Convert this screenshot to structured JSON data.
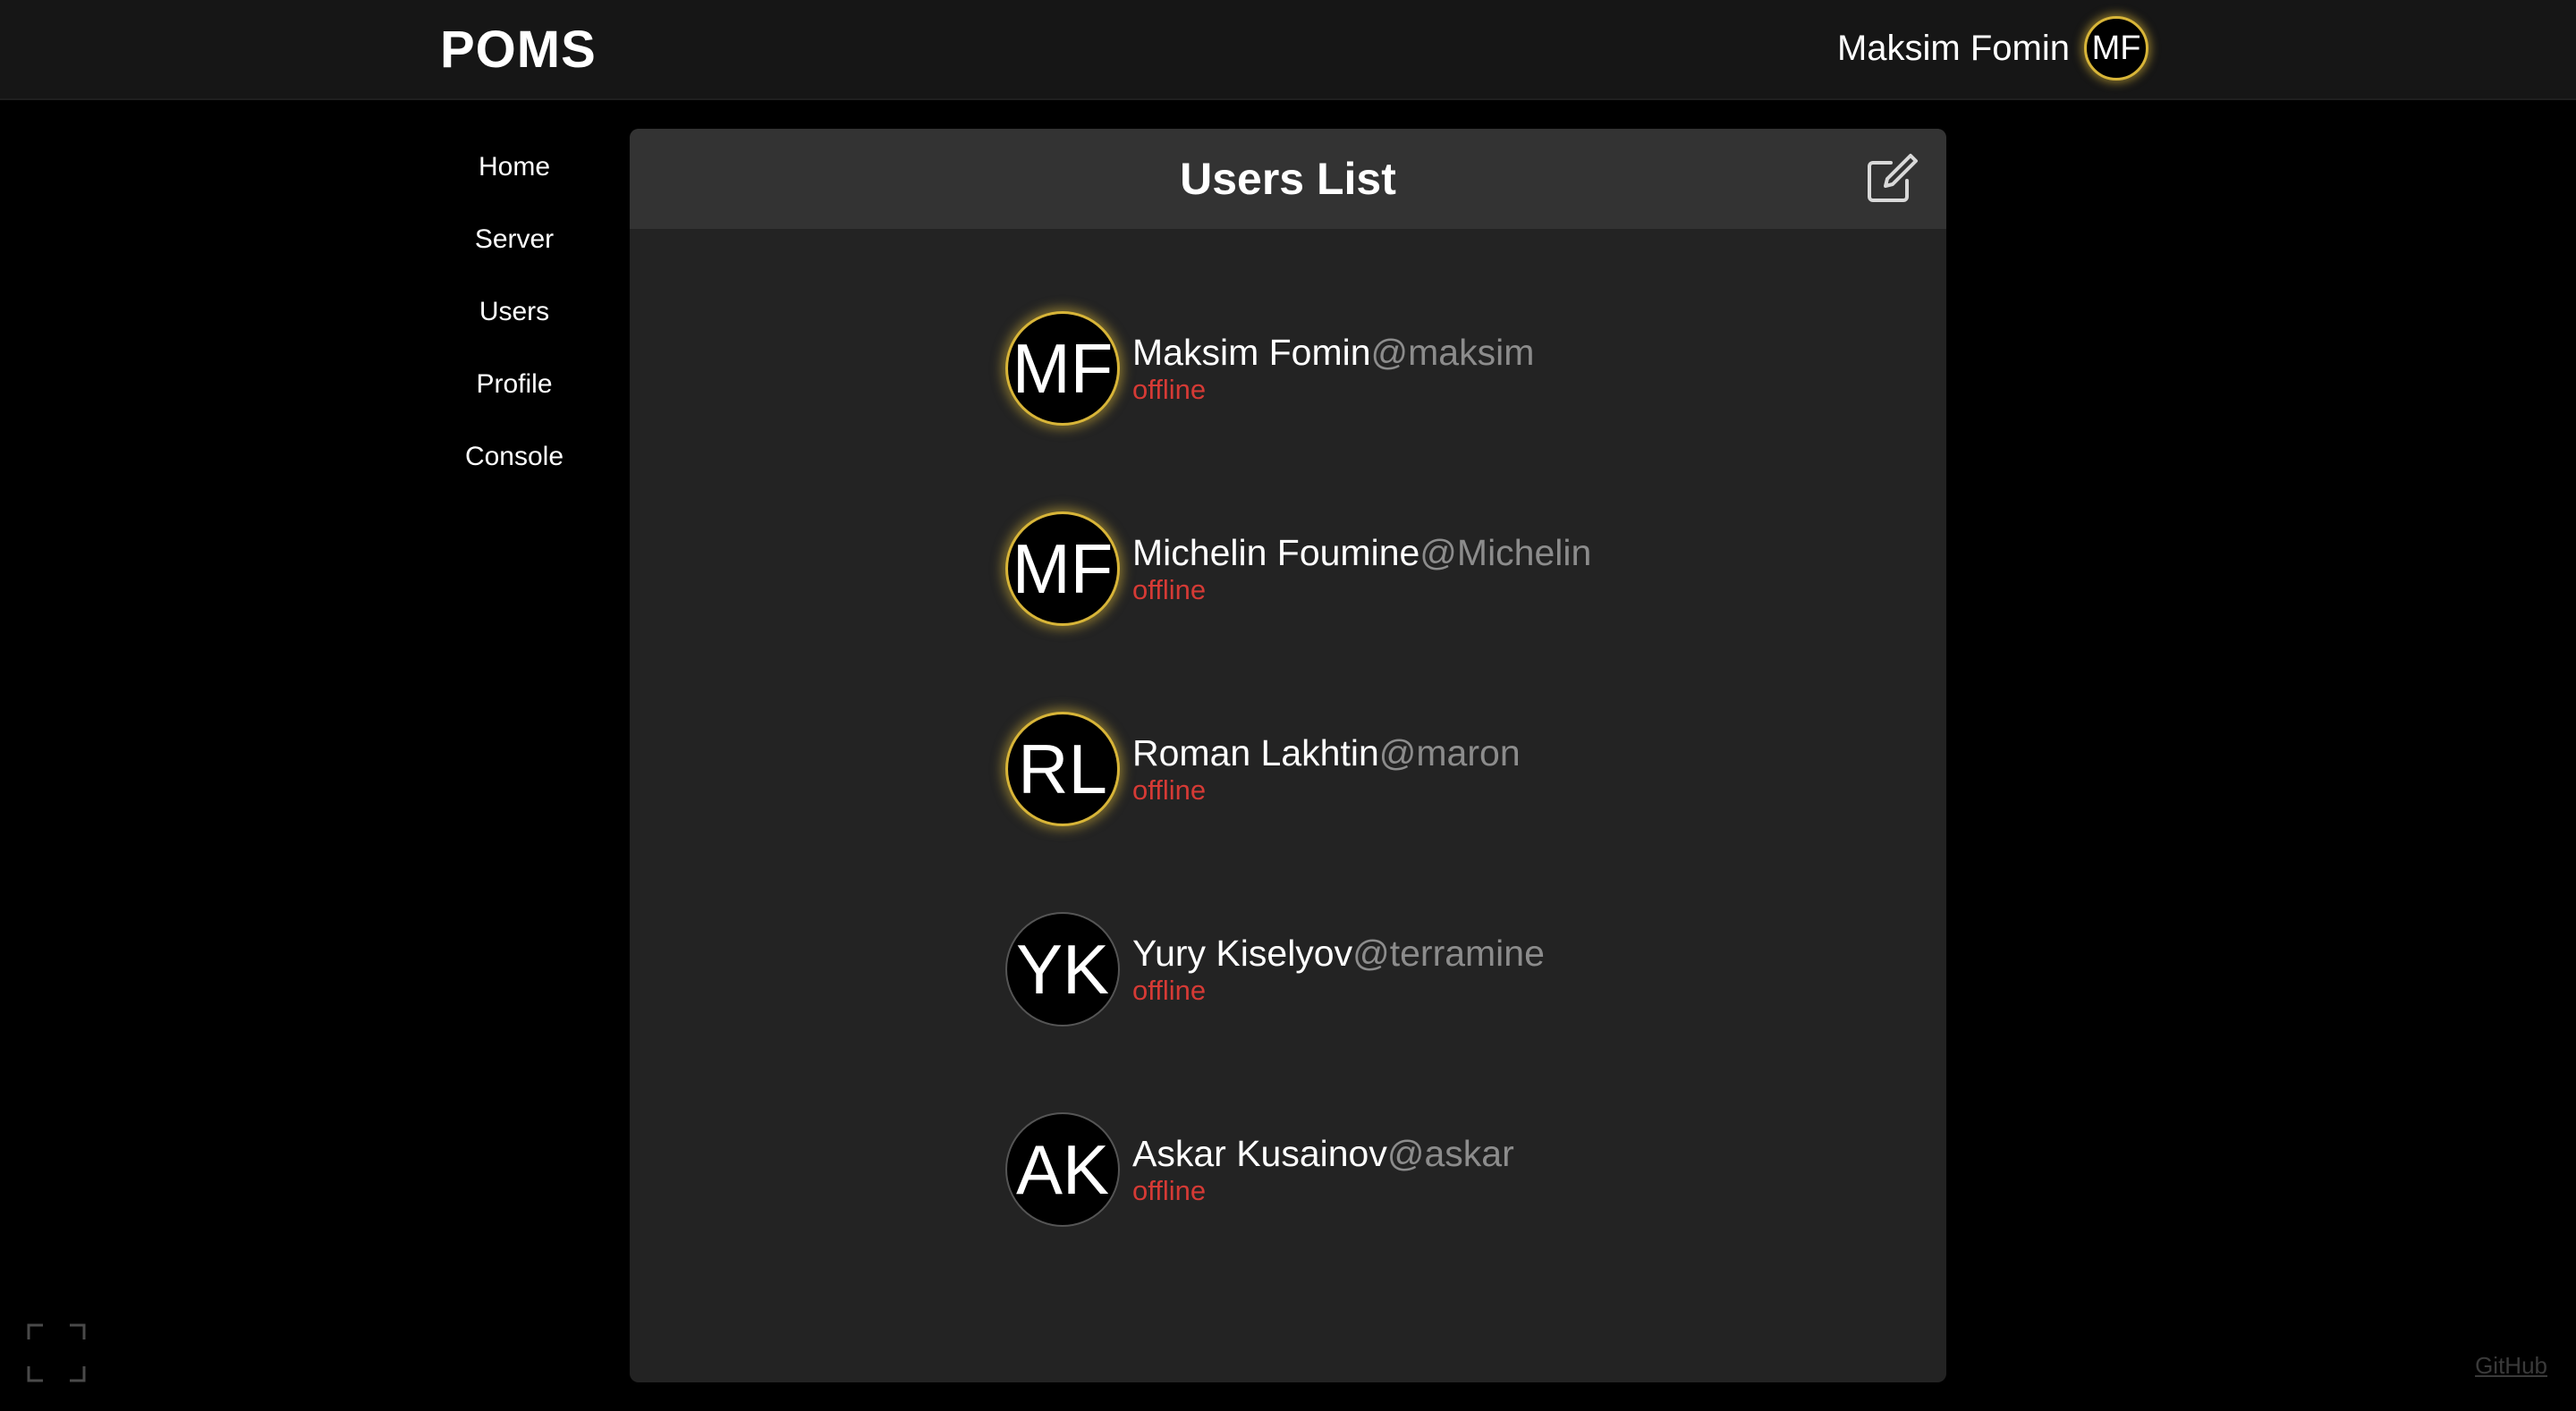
{
  "app": {
    "logo": "POMS"
  },
  "header": {
    "user_name": "Maksim Fomin",
    "user_initials": "MF"
  },
  "sidebar": {
    "items": [
      {
        "label": "Home"
      },
      {
        "label": "Server"
      },
      {
        "label": "Users"
      },
      {
        "label": "Profile"
      },
      {
        "label": "Console"
      }
    ]
  },
  "panel": {
    "title": "Users List",
    "edit_icon": "edit-icon"
  },
  "users": [
    {
      "initials": "MF",
      "name": "Maksim Fomin",
      "handle": "@maksim",
      "status": "offline",
      "ring": true
    },
    {
      "initials": "MF",
      "name": "Michelin Foumine",
      "handle": "@Michelin",
      "status": "offline",
      "ring": true
    },
    {
      "initials": "RL",
      "name": "Roman Lakhtin",
      "handle": "@maron",
      "status": "offline",
      "ring": true
    },
    {
      "initials": "YK",
      "name": "Yury Kiselyov",
      "handle": "@terramine",
      "status": "offline",
      "ring": false
    },
    {
      "initials": "AK",
      "name": "Askar Kusainov",
      "handle": "@askar",
      "status": "offline",
      "ring": false
    }
  ],
  "footer": {
    "github_label": "GitHub",
    "fullscreen_icon": "fullscreen-icon"
  },
  "colors": {
    "accent_ring": "#d8b538",
    "status_offline": "#d53a35",
    "handle": "#8c8c8c"
  }
}
